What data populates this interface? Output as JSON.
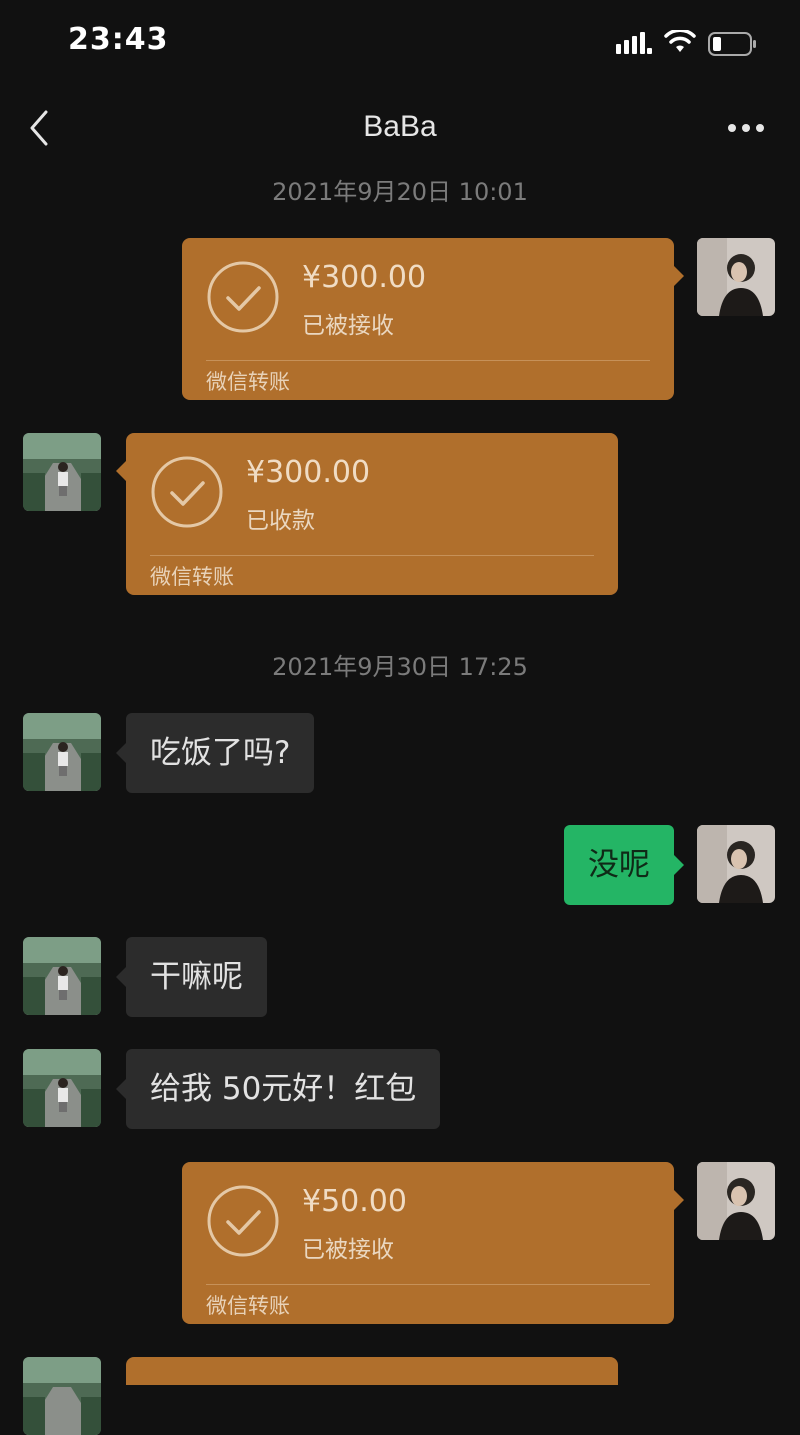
{
  "status_bar": {
    "time": "23:43",
    "icons": [
      "signal-icon",
      "wifi-icon",
      "battery-icon"
    ]
  },
  "nav": {
    "title": "BaBa",
    "back_icon": "chevron-left-icon",
    "more_icon": "more-dots-icon"
  },
  "timestamps": [
    "2021年9月20日 10:01",
    "2021年9月30日 17:25"
  ],
  "messages": [
    {
      "type": "transfer",
      "side": "right",
      "amount": "¥300.00",
      "status": "已被接收",
      "footer": "微信转账"
    },
    {
      "type": "transfer",
      "side": "left",
      "amount": "¥300.00",
      "status": "已收款",
      "footer": "微信转账"
    },
    {
      "type": "text",
      "side": "left",
      "text": "吃饭了吗?"
    },
    {
      "type": "text",
      "side": "right",
      "text": "没呢"
    },
    {
      "type": "text",
      "side": "left",
      "text": "干嘛呢"
    },
    {
      "type": "text",
      "side": "left",
      "text": "给我 50元好！红包"
    },
    {
      "type": "transfer",
      "side": "right",
      "amount": "¥50.00",
      "status": "已被接收",
      "footer": "微信转账"
    }
  ],
  "colors": {
    "background": "#111111",
    "transfer": "#B06F2C",
    "outgoing": "#24B565",
    "incoming": "#2c2c2c"
  }
}
